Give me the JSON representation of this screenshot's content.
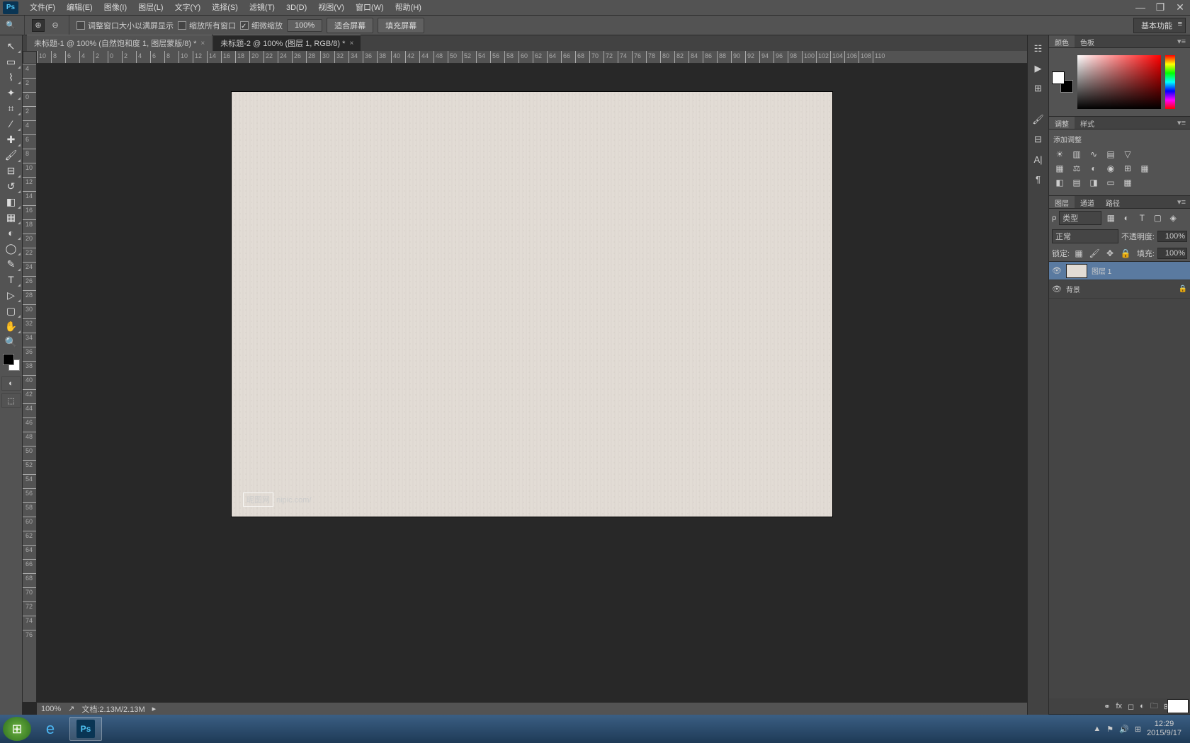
{
  "menu": {
    "file": "文件(F)",
    "edit": "编辑(E)",
    "image": "图像(I)",
    "layer": "图层(L)",
    "type": "文字(Y)",
    "select": "选择(S)",
    "filter": "滤镜(T)",
    "td": "3D(D)",
    "view": "视图(V)",
    "window": "窗口(W)",
    "help": "帮助(H)"
  },
  "options": {
    "resize": "调整窗口大小以满屏显示",
    "zoomall": "缩放所有窗口",
    "scrubby": "细微缩放",
    "zoom": "100%",
    "fit": "适合屏幕",
    "fill": "填充屏幕",
    "workspace": "基本功能"
  },
  "tabs": {
    "t1": "未标题-1 @ 100% (自然饱和度 1, 图层蒙版/8) *",
    "t2": "未标题-2 @ 100% (图层 1, RGB/8) *"
  },
  "watermark": {
    "brand": "昵图网",
    "url": "nipic.com/"
  },
  "status": {
    "zoom": "100%",
    "doc": "文档:2.13M/2.13M"
  },
  "panels": {
    "color": {
      "t1": "颜色",
      "t2": "色板"
    },
    "adj": {
      "t1": "调整",
      "t2": "样式",
      "title": "添加调整"
    },
    "layers": {
      "t1": "图层",
      "t2": "通道",
      "t3": "路径",
      "kind": "类型",
      "blend": "正常",
      "opLabel": "不透明度:",
      "op": "100%",
      "lockLabel": "锁定:",
      "fillLabel": "填充:",
      "fill": "100%",
      "l1": "图层 1",
      "l2": "背景"
    }
  },
  "taskbar": {
    "time": "12:29",
    "date": "2015/9/17"
  },
  "ruler": {
    "h": [
      "10",
      "8",
      "6",
      "4",
      "2",
      "0",
      "2",
      "4",
      "6",
      "8",
      "10",
      "12",
      "14",
      "16",
      "18",
      "20",
      "22",
      "24",
      "26",
      "28",
      "30",
      "32",
      "34",
      "36",
      "38",
      "40",
      "42",
      "44",
      "48",
      "50",
      "52",
      "54",
      "56",
      "58",
      "60",
      "62",
      "64",
      "66",
      "68",
      "70",
      "72",
      "74",
      "76",
      "78",
      "80",
      "82",
      "84",
      "86",
      "88",
      "90",
      "92",
      "94",
      "96",
      "98",
      "100",
      "102",
      "104",
      "106",
      "108",
      "110"
    ],
    "v": [
      "4",
      "2",
      "0",
      "2",
      "4",
      "6",
      "8",
      "10",
      "12",
      "14",
      "16",
      "18",
      "20",
      "22",
      "24",
      "26",
      "28",
      "30",
      "32",
      "34",
      "36",
      "38",
      "40",
      "42",
      "44",
      "46",
      "48",
      "50",
      "52",
      "54",
      "56",
      "58",
      "60",
      "62",
      "64",
      "66",
      "68",
      "70",
      "72",
      "74",
      "76"
    ]
  }
}
